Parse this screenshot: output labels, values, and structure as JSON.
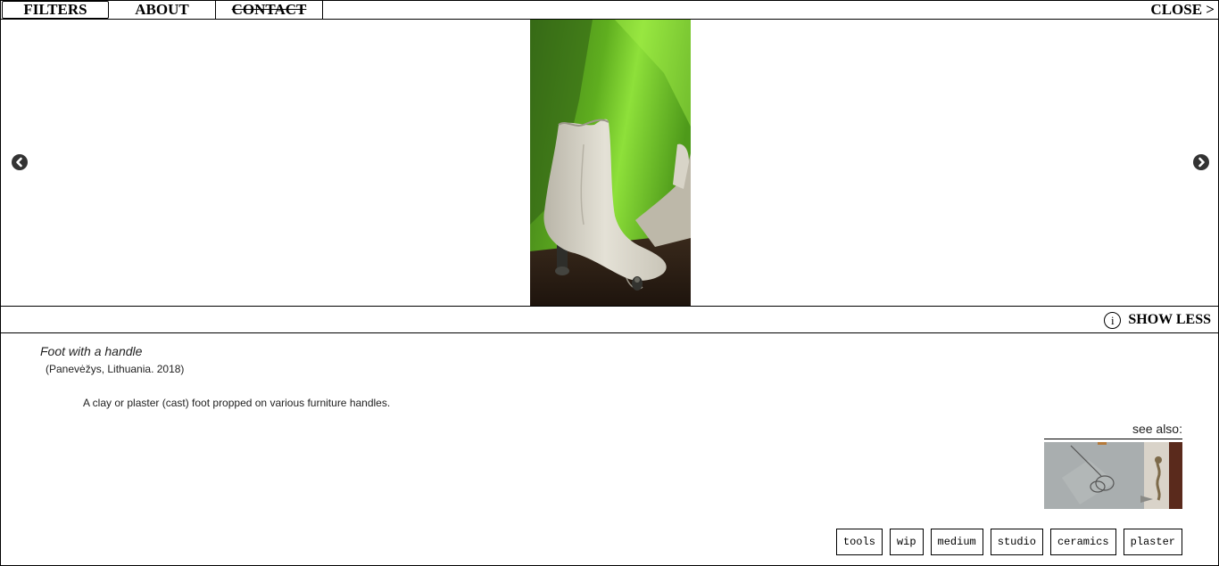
{
  "nav": {
    "tabs": [
      {
        "label": "FILTERS"
      },
      {
        "label": "ABOUT"
      },
      {
        "label": "CONTACT"
      }
    ],
    "close_label": "CLOSE >"
  },
  "viewer": {
    "prev_icon": "chevron-left-circle-icon",
    "next_icon": "chevron-right-circle-icon",
    "image_subject": "clay foot with handle on green background"
  },
  "infobar": {
    "icon": "info-icon",
    "icon_glyph": "i",
    "toggle_label": "SHOW LESS"
  },
  "details": {
    "title": "Foot with a handle",
    "subtitle": "(Panevėžys, Lithuania. 2018)",
    "description": "A clay or plaster (cast) foot propped on various furniture handles.",
    "see_also_label": "see also:",
    "tags": [
      "tools",
      "wip",
      "medium",
      "studio",
      "ceramics",
      "plaster"
    ]
  },
  "colors": {
    "border": "#000000",
    "background": "#ffffff",
    "arrow_fill": "#333333",
    "photo_green": "#6cc61f"
  }
}
